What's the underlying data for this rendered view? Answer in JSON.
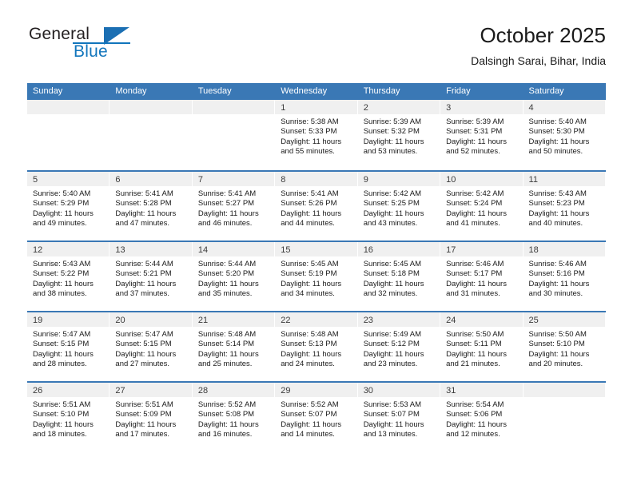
{
  "brand": {
    "name_part1": "General",
    "name_part2": "Blue",
    "accent_color": "#1175bc",
    "triangle_color": "#1b6fb3"
  },
  "header": {
    "title": "October 2025",
    "location": "Dalsingh Sarai, Bihar, India"
  },
  "calendar": {
    "header_bg": "#3a78b5",
    "header_text_color": "#ffffff",
    "daynum_bg": "#f0f0f0",
    "weekdays": [
      "Sunday",
      "Monday",
      "Tuesday",
      "Wednesday",
      "Thursday",
      "Friday",
      "Saturday"
    ],
    "weeks": [
      [
        {
          "day": "",
          "lines": []
        },
        {
          "day": "",
          "lines": []
        },
        {
          "day": "",
          "lines": []
        },
        {
          "day": "1",
          "lines": [
            "Sunrise: 5:38 AM",
            "Sunset: 5:33 PM",
            "Daylight: 11 hours",
            "and 55 minutes."
          ]
        },
        {
          "day": "2",
          "lines": [
            "Sunrise: 5:39 AM",
            "Sunset: 5:32 PM",
            "Daylight: 11 hours",
            "and 53 minutes."
          ]
        },
        {
          "day": "3",
          "lines": [
            "Sunrise: 5:39 AM",
            "Sunset: 5:31 PM",
            "Daylight: 11 hours",
            "and 52 minutes."
          ]
        },
        {
          "day": "4",
          "lines": [
            "Sunrise: 5:40 AM",
            "Sunset: 5:30 PM",
            "Daylight: 11 hours",
            "and 50 minutes."
          ]
        }
      ],
      [
        {
          "day": "5",
          "lines": [
            "Sunrise: 5:40 AM",
            "Sunset: 5:29 PM",
            "Daylight: 11 hours",
            "and 49 minutes."
          ]
        },
        {
          "day": "6",
          "lines": [
            "Sunrise: 5:41 AM",
            "Sunset: 5:28 PM",
            "Daylight: 11 hours",
            "and 47 minutes."
          ]
        },
        {
          "day": "7",
          "lines": [
            "Sunrise: 5:41 AM",
            "Sunset: 5:27 PM",
            "Daylight: 11 hours",
            "and 46 minutes."
          ]
        },
        {
          "day": "8",
          "lines": [
            "Sunrise: 5:41 AM",
            "Sunset: 5:26 PM",
            "Daylight: 11 hours",
            "and 44 minutes."
          ]
        },
        {
          "day": "9",
          "lines": [
            "Sunrise: 5:42 AM",
            "Sunset: 5:25 PM",
            "Daylight: 11 hours",
            "and 43 minutes."
          ]
        },
        {
          "day": "10",
          "lines": [
            "Sunrise: 5:42 AM",
            "Sunset: 5:24 PM",
            "Daylight: 11 hours",
            "and 41 minutes."
          ]
        },
        {
          "day": "11",
          "lines": [
            "Sunrise: 5:43 AM",
            "Sunset: 5:23 PM",
            "Daylight: 11 hours",
            "and 40 minutes."
          ]
        }
      ],
      [
        {
          "day": "12",
          "lines": [
            "Sunrise: 5:43 AM",
            "Sunset: 5:22 PM",
            "Daylight: 11 hours",
            "and 38 minutes."
          ]
        },
        {
          "day": "13",
          "lines": [
            "Sunrise: 5:44 AM",
            "Sunset: 5:21 PM",
            "Daylight: 11 hours",
            "and 37 minutes."
          ]
        },
        {
          "day": "14",
          "lines": [
            "Sunrise: 5:44 AM",
            "Sunset: 5:20 PM",
            "Daylight: 11 hours",
            "and 35 minutes."
          ]
        },
        {
          "day": "15",
          "lines": [
            "Sunrise: 5:45 AM",
            "Sunset: 5:19 PM",
            "Daylight: 11 hours",
            "and 34 minutes."
          ]
        },
        {
          "day": "16",
          "lines": [
            "Sunrise: 5:45 AM",
            "Sunset: 5:18 PM",
            "Daylight: 11 hours",
            "and 32 minutes."
          ]
        },
        {
          "day": "17",
          "lines": [
            "Sunrise: 5:46 AM",
            "Sunset: 5:17 PM",
            "Daylight: 11 hours",
            "and 31 minutes."
          ]
        },
        {
          "day": "18",
          "lines": [
            "Sunrise: 5:46 AM",
            "Sunset: 5:16 PM",
            "Daylight: 11 hours",
            "and 30 minutes."
          ]
        }
      ],
      [
        {
          "day": "19",
          "lines": [
            "Sunrise: 5:47 AM",
            "Sunset: 5:15 PM",
            "Daylight: 11 hours",
            "and 28 minutes."
          ]
        },
        {
          "day": "20",
          "lines": [
            "Sunrise: 5:47 AM",
            "Sunset: 5:15 PM",
            "Daylight: 11 hours",
            "and 27 minutes."
          ]
        },
        {
          "day": "21",
          "lines": [
            "Sunrise: 5:48 AM",
            "Sunset: 5:14 PM",
            "Daylight: 11 hours",
            "and 25 minutes."
          ]
        },
        {
          "day": "22",
          "lines": [
            "Sunrise: 5:48 AM",
            "Sunset: 5:13 PM",
            "Daylight: 11 hours",
            "and 24 minutes."
          ]
        },
        {
          "day": "23",
          "lines": [
            "Sunrise: 5:49 AM",
            "Sunset: 5:12 PM",
            "Daylight: 11 hours",
            "and 23 minutes."
          ]
        },
        {
          "day": "24",
          "lines": [
            "Sunrise: 5:50 AM",
            "Sunset: 5:11 PM",
            "Daylight: 11 hours",
            "and 21 minutes."
          ]
        },
        {
          "day": "25",
          "lines": [
            "Sunrise: 5:50 AM",
            "Sunset: 5:10 PM",
            "Daylight: 11 hours",
            "and 20 minutes."
          ]
        }
      ],
      [
        {
          "day": "26",
          "lines": [
            "Sunrise: 5:51 AM",
            "Sunset: 5:10 PM",
            "Daylight: 11 hours",
            "and 18 minutes."
          ]
        },
        {
          "day": "27",
          "lines": [
            "Sunrise: 5:51 AM",
            "Sunset: 5:09 PM",
            "Daylight: 11 hours",
            "and 17 minutes."
          ]
        },
        {
          "day": "28",
          "lines": [
            "Sunrise: 5:52 AM",
            "Sunset: 5:08 PM",
            "Daylight: 11 hours",
            "and 16 minutes."
          ]
        },
        {
          "day": "29",
          "lines": [
            "Sunrise: 5:52 AM",
            "Sunset: 5:07 PM",
            "Daylight: 11 hours",
            "and 14 minutes."
          ]
        },
        {
          "day": "30",
          "lines": [
            "Sunrise: 5:53 AM",
            "Sunset: 5:07 PM",
            "Daylight: 11 hours",
            "and 13 minutes."
          ]
        },
        {
          "day": "31",
          "lines": [
            "Sunrise: 5:54 AM",
            "Sunset: 5:06 PM",
            "Daylight: 11 hours",
            "and 12 minutes."
          ]
        },
        {
          "day": "",
          "lines": []
        }
      ]
    ]
  }
}
